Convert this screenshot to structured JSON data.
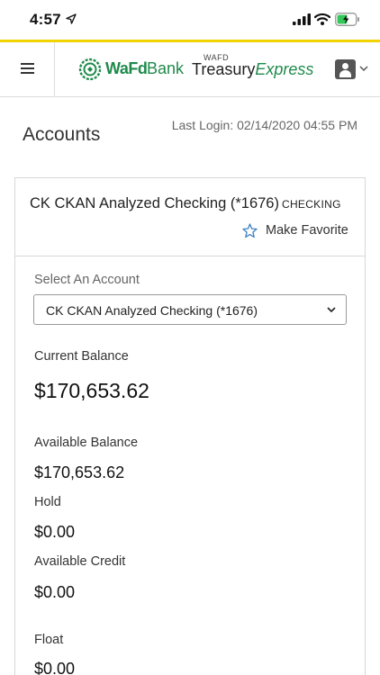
{
  "status_bar": {
    "time": "4:57"
  },
  "header": {
    "bank_name_bold": "WaFd",
    "bank_name_rest": "Bank",
    "product_small": "WAFD",
    "product_main": "Treasury",
    "product_accent": "Express"
  },
  "page": {
    "title": "Accounts",
    "last_login": "Last Login: 02/14/2020 04:55 PM"
  },
  "account": {
    "name": "CK CKAN Analyzed Checking (*1676)",
    "type": "CHECKING",
    "favorite_label": "Make Favorite",
    "select_label": "Select An Account",
    "selected_account": "CK CKAN Analyzed Checking (*1676)"
  },
  "balances": {
    "current_label": "Current Balance",
    "current_value": "$170,653.62",
    "available_label": "Available Balance",
    "available_value": "$170,653.62",
    "hold_label": "Hold",
    "hold_value": "$0.00",
    "available_credit_label": "Available Credit",
    "available_credit_value": "$0.00",
    "float_label": "Float",
    "float_value": "$0.00"
  },
  "colors": {
    "accent_yellow": "#f2d300",
    "brand_green": "#1f8a4c"
  },
  "icons": [
    "location-arrow-icon",
    "cellular-signal-icon",
    "wifi-icon",
    "battery-charging-icon",
    "hamburger-menu-icon",
    "wafd-logo-icon",
    "user-icon",
    "chevron-down-icon",
    "star-icon"
  ]
}
